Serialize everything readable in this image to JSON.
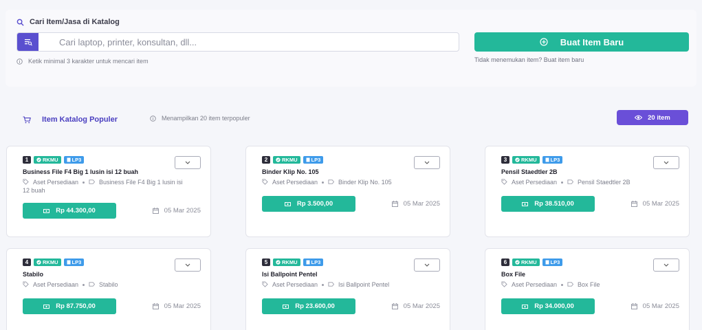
{
  "search": {
    "title": "Cari Item/Jasa di Katalog",
    "placeholder": "Cari laptop, printer, konsultan, dll...",
    "value": "",
    "hint": "Ketik minimal 3 karakter untuk mencari item"
  },
  "create": {
    "label": "Buat Item Baru",
    "hint": "Tidak menemukan item? Buat item baru"
  },
  "popular": {
    "title": "Item Katalog Populer",
    "subtitle": "Menampilkan 20 item terpopuler",
    "count_label": "20 item"
  },
  "colors": {
    "accent": "#5a4fcf",
    "success": "#23b89a",
    "info": "#3e9bea"
  },
  "items": [
    {
      "num": "1",
      "tag1": "RKMU",
      "tag2": "LP3",
      "name": "Business File F4 Big 1 lusin isi 12 buah",
      "category": "Aset Persediaan",
      "subcategory": "Business File F4 Big 1 lusin isi 12 buah",
      "price": "Rp 44.300,00",
      "date": "05 Mar 2025"
    },
    {
      "num": "2",
      "tag1": "RKMU",
      "tag2": "LP3",
      "name": "Binder Klip No. 105",
      "category": "Aset Persediaan",
      "subcategory": "Binder Klip No. 105",
      "price": "Rp 3.500,00",
      "date": "05 Mar 2025"
    },
    {
      "num": "3",
      "tag1": "RKMU",
      "tag2": "LP3",
      "name": "Pensil Staedtler 2B",
      "category": "Aset Persediaan",
      "subcategory": "Pensil Staedtler 2B",
      "price": "Rp 38.510,00",
      "date": "05 Mar 2025"
    },
    {
      "num": "4",
      "tag1": "RKMU",
      "tag2": "LP3",
      "name": "Stabilo",
      "category": "Aset Persediaan",
      "subcategory": "Stabilo",
      "price": "Rp 87.750,00",
      "date": "05 Mar 2025"
    },
    {
      "num": "5",
      "tag1": "RKMU",
      "tag2": "LP3",
      "name": "Isi Ballpoint Pentel",
      "category": "Aset Persediaan",
      "subcategory": "Isi Ballpoint Pentel",
      "price": "Rp 23.600,00",
      "date": "05 Mar 2025"
    },
    {
      "num": "6",
      "tag1": "RKMU",
      "tag2": "LP3",
      "name": "Box File",
      "category": "Aset Persediaan",
      "subcategory": "Box File",
      "price": "Rp 34.000,00",
      "date": "05 Mar 2025"
    }
  ]
}
